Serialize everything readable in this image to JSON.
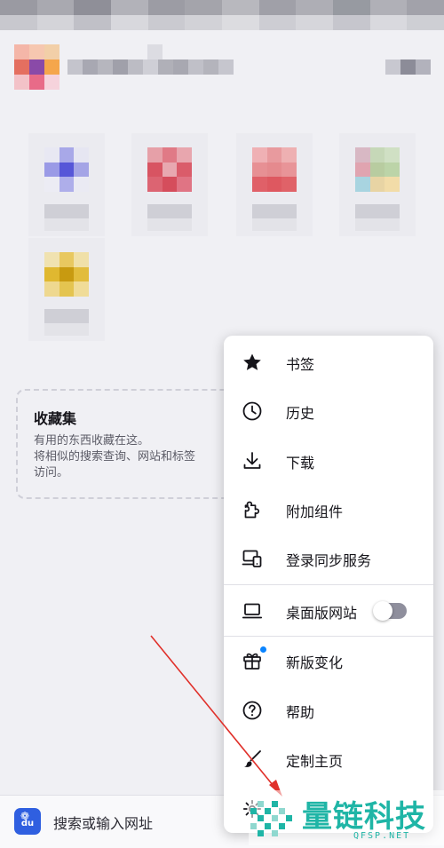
{
  "collections": {
    "title": "收藏集",
    "description": "有用的东西收藏在这。\n将相似的搜索查询、网站和标签\n访问。"
  },
  "toolbar": {
    "search_placeholder": "搜索或输入网址",
    "engine_icon": "baidu-icon",
    "engine_text": "du"
  },
  "menu": {
    "items": [
      {
        "label": "书签",
        "icon": "star-icon"
      },
      {
        "label": "历史",
        "icon": "clock-icon"
      },
      {
        "label": "下载",
        "icon": "download-icon"
      },
      {
        "label": "附加组件",
        "icon": "puzzle-icon"
      },
      {
        "label": "登录同步服务",
        "icon": "sync-devices-icon"
      },
      {
        "label": "桌面版网站",
        "icon": "laptop-icon",
        "toggle_on": false
      },
      {
        "label": "新版变化",
        "icon": "gift-icon"
      },
      {
        "label": "帮助",
        "icon": "help-icon"
      },
      {
        "label": "定制主页",
        "icon": "brush-icon"
      }
    ]
  },
  "watermark": {
    "title": "量链科技",
    "url": "QFSP.NET"
  },
  "colors": {
    "accent": "#0a84ff",
    "arrow": "#e0302a",
    "watermark": "#1fb5a6"
  }
}
